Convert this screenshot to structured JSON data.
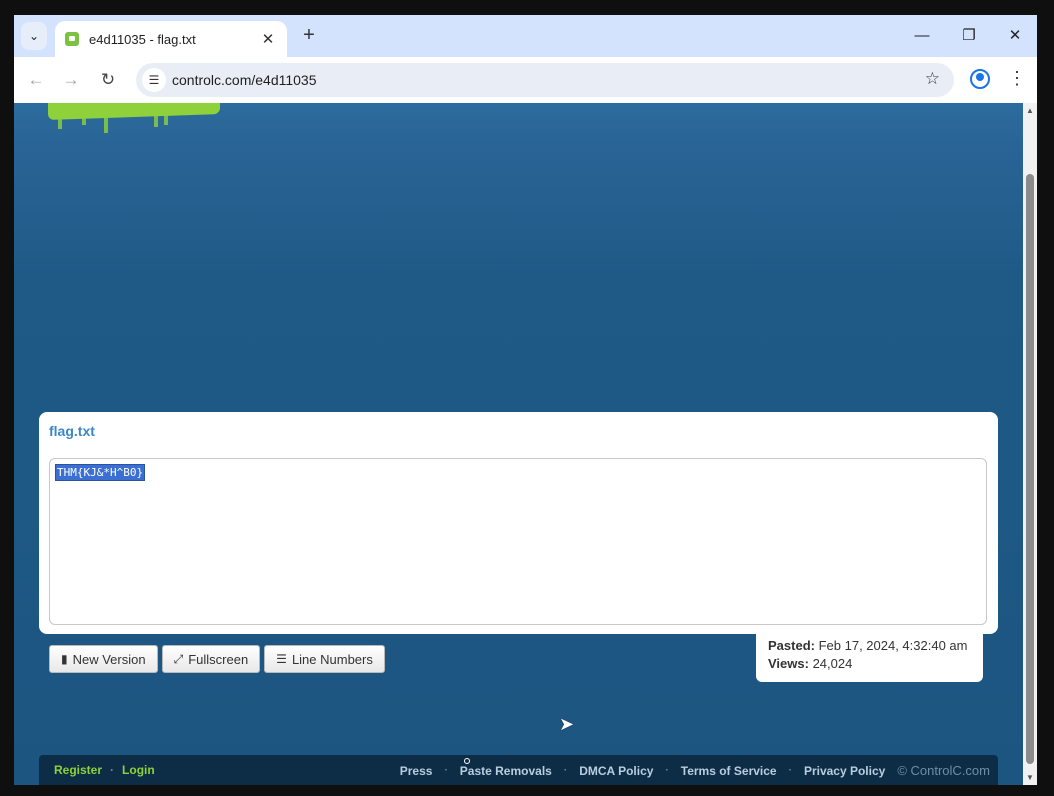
{
  "browser": {
    "tab_title": "e4d11035 - flag.txt",
    "url": "controlc.com/e4d11035",
    "icons": {
      "tab_search": "chevron-down-icon",
      "close_tab": "close-icon",
      "new_tab": "plus-icon",
      "minimize": "minimize-icon",
      "restore": "restore-icon",
      "close_window": "close-icon",
      "back": "arrow-left-icon",
      "forward": "arrow-right-icon",
      "reload": "reload-icon",
      "site_info": "tune-icon",
      "bookmark": "star-icon",
      "profile": "profile-icon",
      "menu": "more-vert-icon"
    }
  },
  "paste": {
    "title": "flag.txt",
    "content": "THM{KJ&*H^B0}"
  },
  "buttons": {
    "new_version": "New Version",
    "fullscreen": "Fullscreen",
    "line_numbers": "Line Numbers"
  },
  "info": {
    "pasted_label": "Pasted:",
    "pasted_value": "Feb 17, 2024, 4:32:40 am",
    "views_label": "Views:",
    "views_value": "24,024"
  },
  "footer": {
    "register": "Register",
    "login": "Login",
    "left_sep": "·",
    "links": [
      "Press",
      "Paste Removals",
      "DMCA Policy",
      "Terms of Service",
      "Privacy Policy"
    ],
    "sep": "·",
    "copyright": "© ControlC.com"
  },
  "colors": {
    "accent_green": "#8fd13a",
    "page_blue": "#1c5580",
    "title_blue": "#3a87c6",
    "selection": "#3b6fd1"
  }
}
